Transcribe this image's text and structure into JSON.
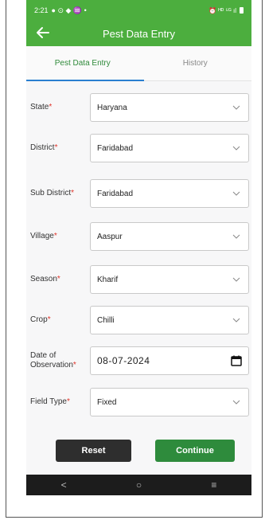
{
  "status_bar": {
    "time": "2:21",
    "left_icons": "● ⊙ ◆ ♒ •",
    "right_icons": "⏰ ᴴᴰ ⁵ᴳ ıl"
  },
  "app_bar": {
    "back_icon": "arrow-left-icon",
    "title": "Pest Data Entry"
  },
  "tabs": [
    {
      "label": "Pest Data Entry",
      "active": true
    },
    {
      "label": "History",
      "active": false
    }
  ],
  "form": {
    "fields": [
      {
        "label": "State",
        "value": "Haryana",
        "type": "select"
      },
      {
        "label": "District",
        "value": "Faridabad",
        "type": "select"
      },
      {
        "label": "Sub District",
        "value": "Faridabad",
        "type": "select"
      },
      {
        "label": "Village",
        "value": "Aaspur",
        "type": "select"
      },
      {
        "label": "Season",
        "value": "Kharif",
        "type": "select"
      },
      {
        "label": "Crop",
        "value": "Chilli",
        "type": "select"
      },
      {
        "label": "Date of Observation",
        "value": "08-07-2024",
        "type": "date"
      },
      {
        "label": "Field Type",
        "value": "Fixed",
        "type": "select"
      }
    ],
    "required_marker": "*"
  },
  "buttons": {
    "reset": "Reset",
    "continue": "Continue"
  },
  "nav_bar": {
    "back": "<",
    "home": "○",
    "recents": "≡"
  },
  "colors": {
    "app_bar": "#4cae3e",
    "tab_active_text": "#2f8a3a",
    "tab_underline": "#2a7fd0",
    "required": "#e0342b",
    "reset_button": "#2e2e2e",
    "continue_button": "#2e8b3c"
  }
}
